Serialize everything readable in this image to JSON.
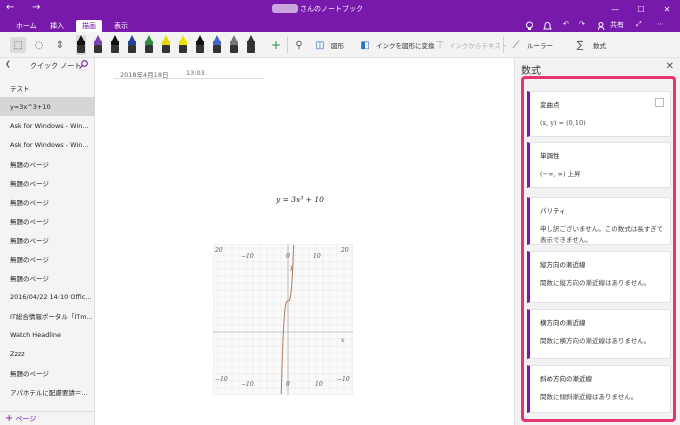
{
  "titlebar": {
    "title": "さんのノートブック",
    "back_icon": "←",
    "forward_icon": "→",
    "window_controls": [
      "—",
      "☐",
      "✕"
    ]
  },
  "ribbon": {
    "tabs": [
      "ホーム",
      "挿入",
      "描画",
      "表示"
    ],
    "active_tab": "描画",
    "share_label": "共有",
    "shapes_label": "図形",
    "ink_to_shape_label": "インクを図形に変換",
    "ink_to_text_label": "インクからテキスト",
    "ruler_label": "ルーラー",
    "math_label": "数式",
    "pen_colors": [
      "#111111",
      "#7a3fb5",
      "#111111",
      "#1f3f99",
      "#2e8b3e",
      "#e8d700",
      "#f0e000",
      "#111111",
      "#4466cc",
      "#777777",
      "#333333"
    ]
  },
  "sidebar": {
    "notebook": "クイック ノート",
    "items": [
      "テスト",
      "y=3x^3+10",
      "Ask for Windows - Win...",
      "Ask for Windows - Win...",
      "無題のページ",
      "無題のページ",
      "無題のページ",
      "無題のページ",
      "無題のページ",
      "無題のページ",
      "無題のページ",
      "2016/04/22 14:10 Offic...",
      "IT総合情報ポータル「ITm...",
      "Watch Headline",
      "Zzzz",
      "無題のページ",
      "アパホテルに配慮要請＝..."
    ],
    "selected_index": 1,
    "add_page_label": "ページ"
  },
  "page": {
    "date": "2018年4月18日",
    "time": "13:03",
    "equation": "y = 3x³ + 10",
    "graph": {
      "x_ticks": [
        "−10",
        "0",
        "10"
      ],
      "y_ticks": [
        "20",
        "10",
        "0",
        "−10"
      ],
      "corner_labels": [
        "20",
        "20",
        "−10",
        "−10"
      ],
      "x_axis_label": "x",
      "y_axis_label": "y",
      "curve_color": "#b07a5a"
    }
  },
  "panel": {
    "title": "数式",
    "cards": [
      {
        "title": "変曲点",
        "body": "(x, y) = (0,10)",
        "math": true,
        "checkbox": true
      },
      {
        "title": "単調性",
        "body": "(−∞, ∞) 上昇",
        "math": true,
        "checkbox": false
      },
      {
        "title": "パリティ",
        "body": "申し訳ございません。この数式は長すぎて表示できません。",
        "math": false,
        "checkbox": false
      },
      {
        "title": "縦方向の漸近線",
        "body": "関数に縦方向の漸近線はありません。",
        "math": false,
        "checkbox": false
      },
      {
        "title": "横方向の漸近線",
        "body": "関数に横方向の漸近線はありません。",
        "math": false,
        "checkbox": false
      },
      {
        "title": "斜め方向の漸近線",
        "body": "関数に傾斜漸近線はありません。",
        "math": false,
        "checkbox": false
      }
    ],
    "highlight_color": "#e8336d"
  }
}
